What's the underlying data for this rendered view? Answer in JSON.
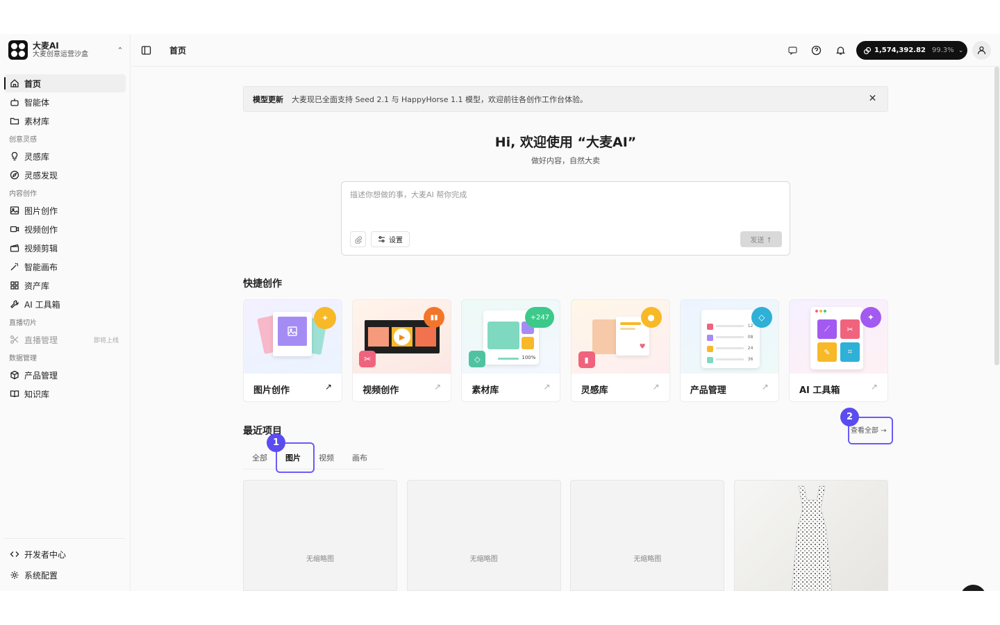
{
  "brand": {
    "name": "大麦AI",
    "subtitle": "大麦创意运营沙盒"
  },
  "sidebar": {
    "top_items": [
      {
        "label": "首页"
      },
      {
        "label": "智能体"
      },
      {
        "label": "素材库"
      }
    ],
    "sections": [
      {
        "title": "创意灵感",
        "items": [
          {
            "label": "灵感库"
          },
          {
            "label": "灵感发现"
          }
        ]
      },
      {
        "title": "内容创作",
        "items": [
          {
            "label": "图片创作"
          },
          {
            "label": "视频创作"
          },
          {
            "label": "视频剪辑"
          },
          {
            "label": "智能画布"
          },
          {
            "label": "资产库"
          },
          {
            "label": "AI 工具箱"
          }
        ]
      },
      {
        "title": "直播切片",
        "items": [
          {
            "label": "直播管理",
            "note": "即将上线"
          }
        ]
      },
      {
        "title": "数据管理",
        "items": [
          {
            "label": "产品管理"
          },
          {
            "label": "知识库"
          }
        ]
      }
    ],
    "bottom_items": [
      {
        "label": "开发者中心"
      },
      {
        "label": "系统配置"
      }
    ]
  },
  "header": {
    "title": "首页",
    "credits": {
      "value": "1,574,392.82",
      "percent": "99.3%"
    }
  },
  "announcement": {
    "tag": "模型更新",
    "message": "大麦现已全面支持 Seed 2.1 与 HappyHorse 1.1 模型，欢迎前往各创作工作台体验。"
  },
  "welcome": {
    "title": "Hi, 欢迎使用 “大麦AI”",
    "subtitle": "做好内容，自然大卖"
  },
  "prompt": {
    "placeholder": "描述你想做的事，大麦AI 帮你完成",
    "settings_label": "设置",
    "send_label": "发送 ↑"
  },
  "quick": {
    "title": "快捷创作",
    "cards": [
      {
        "label": "图片创作"
      },
      {
        "label": "视频创作"
      },
      {
        "label": "素材库",
        "badge": "+247"
      },
      {
        "label": "灵感库"
      },
      {
        "label": "产品管理",
        "numbers": [
          "12",
          "08",
          "24",
          "36"
        ]
      },
      {
        "label": "AI 工具箱"
      }
    ],
    "material_progress": "100%"
  },
  "recent": {
    "title": "最近项目",
    "view_all": "查看全部 →",
    "tabs": [
      {
        "label": "全部"
      },
      {
        "label": "图片"
      },
      {
        "label": "视频"
      },
      {
        "label": "画布"
      }
    ],
    "no_thumb": "无缩略图"
  },
  "annotations": [
    "1",
    "2"
  ],
  "colors": {
    "accent": "#5b4cf0",
    "dark": "#111111"
  }
}
